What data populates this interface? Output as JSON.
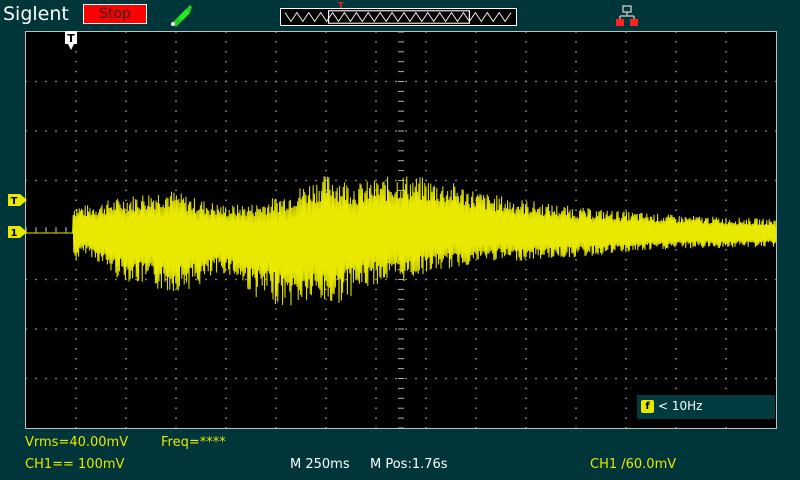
{
  "header": {
    "brand": "Siglent",
    "run_state": "Stop",
    "trigger_mark": "T"
  },
  "screen": {
    "grid": {
      "h_divisions": 15,
      "v_divisions": 8,
      "h_subdivisions": 5
    }
  },
  "markers": {
    "trigger_position": "T",
    "trigger_level": "T",
    "ch1_ground": "1"
  },
  "frequency_counter": {
    "icon_label": "f",
    "value": "< 10Hz"
  },
  "measurements": {
    "vrms": "Vrms=40.00mV",
    "freq": "Freq=****"
  },
  "status_bar": {
    "ch1_scale": "CH1== 100mV",
    "timebase": "M 250ms",
    "position": "M Pos:1.76s",
    "trigger": "CH1 /60.0mV"
  },
  "colors": {
    "ch1": "#e8e800",
    "background": "#00353a",
    "grid": "#b0b0b0"
  }
}
